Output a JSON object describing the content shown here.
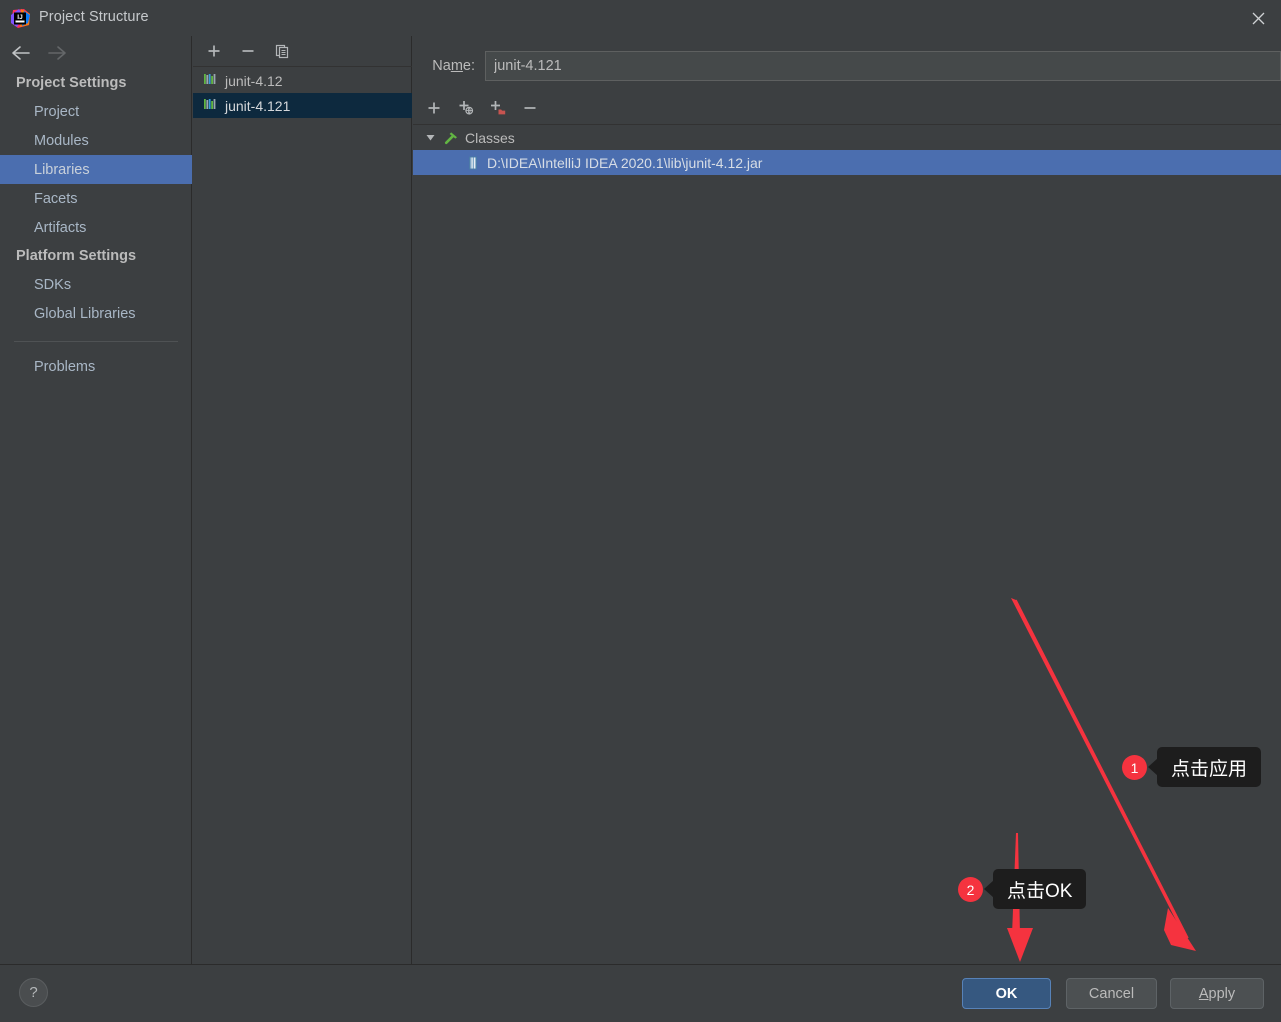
{
  "window": {
    "title": "Project Structure",
    "logo_icon": "intellij-idea-logo",
    "close_icon": "close-icon"
  },
  "nav": {
    "back_icon": "arrow-left-icon",
    "forward_icon": "arrow-right-icon"
  },
  "sidebar": {
    "groups": [
      {
        "title": "Project Settings",
        "items": [
          {
            "label": "Project",
            "selected": false
          },
          {
            "label": "Modules",
            "selected": false
          },
          {
            "label": "Libraries",
            "selected": true
          },
          {
            "label": "Facets",
            "selected": false
          },
          {
            "label": "Artifacts",
            "selected": false
          }
        ]
      },
      {
        "title": "Platform Settings",
        "items": [
          {
            "label": "SDKs",
            "selected": false
          },
          {
            "label": "Global Libraries",
            "selected": false
          }
        ]
      }
    ],
    "extra_items": [
      {
        "label": "Problems",
        "selected": false
      }
    ]
  },
  "libraries_panel": {
    "toolbar": [
      {
        "name": "add-library-button",
        "icon": "plus-icon"
      },
      {
        "name": "remove-library-button",
        "icon": "minus-icon"
      },
      {
        "name": "copy-library-button",
        "icon": "copy-icon"
      }
    ],
    "items": [
      {
        "label": "junit-4.12",
        "icon": "library-icon",
        "selected": false
      },
      {
        "label": "junit-4.121",
        "icon": "library-icon",
        "selected": true
      }
    ]
  },
  "detail_panel": {
    "name_label": "Na",
    "name_label_mnemonic": "m",
    "name_label_tail": "e:",
    "name_value": "junit-4.121",
    "name_placeholder": "",
    "toolbar": [
      {
        "name": "add-button",
        "icon": "plus-icon"
      },
      {
        "name": "add-from-url-button",
        "icon": "plus-globe-icon"
      },
      {
        "name": "add-from-folder-button",
        "icon": "plus-folder-icon"
      },
      {
        "name": "remove-button",
        "icon": "minus-icon"
      }
    ],
    "tree": {
      "root": {
        "label": "Classes",
        "icon": "hammer-icon",
        "toggle_icon": "triangle-down-icon",
        "expanded": true
      },
      "children": [
        {
          "label": "D:\\IDEA\\IntelliJ IDEA 2020.1\\lib\\junit-4.12.jar",
          "icon": "jar-file-icon",
          "selected": true
        }
      ]
    }
  },
  "footer": {
    "help_label": "?",
    "buttons": [
      {
        "name": "ok-button",
        "label": "OK",
        "primary": true
      },
      {
        "name": "cancel-button",
        "label": "Cancel",
        "primary": false
      },
      {
        "name": "apply-button",
        "label": "Appl",
        "mnemonic": "A",
        "tail": "pply",
        "primary": false
      }
    ],
    "apply_head": "A",
    "apply_tail": "pply"
  },
  "annotations": {
    "accent_color": "#f5333f",
    "items": [
      {
        "badge": "1",
        "text": "点击应用"
      },
      {
        "badge": "2",
        "text": "点击OK"
      }
    ]
  }
}
